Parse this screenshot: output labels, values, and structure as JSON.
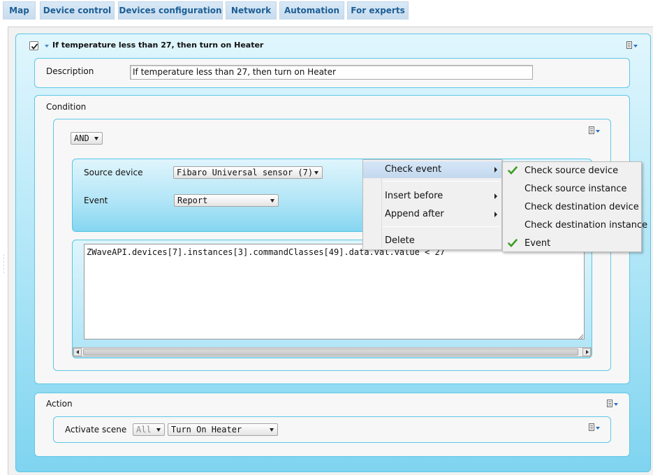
{
  "tabs": [
    {
      "label": "Map"
    },
    {
      "label": "Device control"
    },
    {
      "label": "Devices configuration"
    },
    {
      "label": "Network"
    },
    {
      "label": "Automation"
    },
    {
      "label": "For experts"
    }
  ],
  "scene": {
    "enabled": true,
    "title": "If temperature less than 27, then turn on Heater",
    "menu_icon": "list-menu-icon"
  },
  "description": {
    "label": "Description",
    "value": "If temperature less than 27, then turn on Heater"
  },
  "condition": {
    "label": "Condition",
    "operator": "AND",
    "event_block": {
      "source_device_label": "Source device",
      "source_device_value": "Fibaro Universal sensor (7)",
      "event_label": "Event",
      "event_value": "Report"
    },
    "expression": "ZWaveAPI.devices[7].instances[3].commandClasses[49].data.val.value < 27"
  },
  "action": {
    "label": "Action",
    "activate_label": "Activate scene",
    "filter_value": "All",
    "scene_value": "Turn On Heater"
  },
  "context_menu": {
    "items": [
      {
        "label": "Check event",
        "has_submenu": true,
        "active": true
      },
      {
        "label": "Insert before",
        "has_submenu": true
      },
      {
        "label": "Append after",
        "has_submenu": true
      },
      {
        "label": "Delete",
        "has_submenu": false
      }
    ]
  },
  "submenu": {
    "items": [
      {
        "label": "Check source device",
        "checked": true
      },
      {
        "label": "Check source instance",
        "checked": false
      },
      {
        "label": "Check destination device",
        "checked": false
      },
      {
        "label": "Check destination instance",
        "checked": false
      },
      {
        "label": "Event",
        "checked": true
      }
    ]
  },
  "colors": {
    "tab_text": "#1d5e95",
    "panel_border": "#5ec8e6",
    "check_green": "#3a9d23"
  }
}
